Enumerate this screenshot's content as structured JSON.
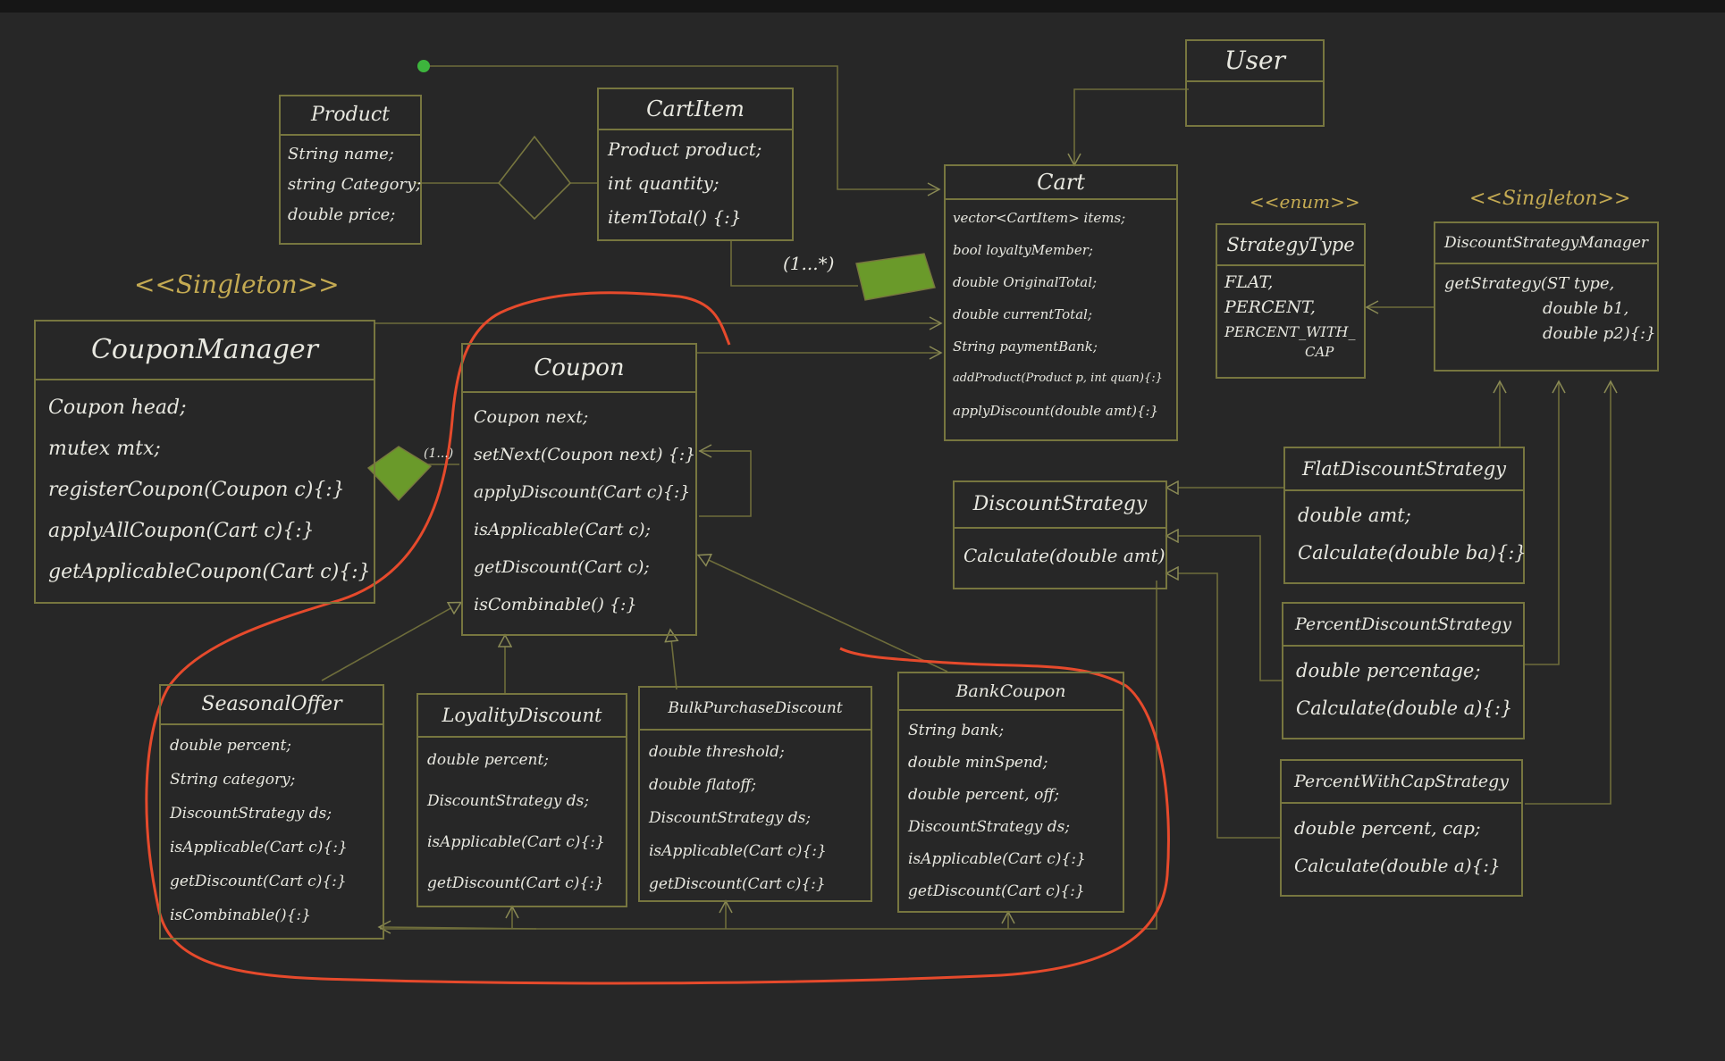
{
  "colors": {
    "background": "#272727",
    "box_border": "#77763f",
    "text": "#e8e8e0",
    "stereotype": "#c4aa52",
    "highlight": "#e64a2c",
    "dot": "#3db53d",
    "diamond_fill": "#6a9a2a"
  },
  "stereotypes": {
    "coupon_manager": "<<Singleton>>",
    "strategy_type": "<<enum>>",
    "discount_strategy_manager": "<<Singleton>>"
  },
  "multiplicity": {
    "cart_items": "(1...*)",
    "coupon_chain": "(1...)"
  },
  "classes": {
    "user": {
      "name": "User"
    },
    "product": {
      "name": "Product",
      "fields": [
        "String name;",
        "string Category;",
        "double price;"
      ]
    },
    "cart_item": {
      "name": "CartItem",
      "fields": [
        "Product product;",
        "int quantity;",
        "itemTotal() {:}"
      ]
    },
    "cart": {
      "name": "Cart",
      "fields": [
        "vector<CartItem> items;",
        "bool loyaltyMember;",
        "double OriginalTotal;",
        "double currentTotal;",
        "String paymentBank;",
        "addProduct(Product p, int quan){:}",
        "applyDiscount(double amt){:}"
      ]
    },
    "strategy_type": {
      "name": "StrategyType",
      "fields": [
        "FLAT,",
        "PERCENT,",
        "PERCENT_WITH_",
        "CAP"
      ]
    },
    "discount_strategy_manager": {
      "name": "DiscountStrategyManager",
      "fields": [
        "getStrategy(ST type,",
        "double b1,",
        "double p2){:}"
      ]
    },
    "coupon_manager": {
      "name": "CouponManager",
      "fields": [
        "Coupon head;",
        "mutex mtx;",
        "registerCoupon(Coupon c){:}",
        "applyAllCoupon(Cart c){:}",
        "getApplicableCoupon(Cart c){:}"
      ]
    },
    "coupon": {
      "name": "Coupon",
      "fields": [
        "Coupon next;",
        "setNext(Coupon next) {:}",
        "applyDiscount(Cart c){:}",
        "isApplicable(Cart c);",
        "getDiscount(Cart c);",
        "isCombinable() {:}"
      ]
    },
    "discount_strategy": {
      "name": "DiscountStrategy",
      "fields": [
        "Calculate(double amt)"
      ]
    },
    "flat_discount_strategy": {
      "name": "FlatDiscountStrategy",
      "fields": [
        "double amt;",
        "Calculate(double ba){:}"
      ]
    },
    "percent_discount_strategy": {
      "name": "PercentDiscountStrategy",
      "fields": [
        "double percentage;",
        "Calculate(double a){:}"
      ]
    },
    "percent_with_cap_strategy": {
      "name": "PercentWithCapStrategy",
      "fields": [
        "double percent, cap;",
        "Calculate(double a){:}"
      ]
    },
    "seasonal_offer": {
      "name": "SeasonalOffer",
      "fields": [
        "double percent;",
        "String category;",
        "DiscountStrategy ds;",
        "isApplicable(Cart c){:}",
        "getDiscount(Cart c){:}",
        "isCombinable(){:}"
      ]
    },
    "loyalty_discount": {
      "name": "LoyalityDiscount",
      "fields": [
        "double percent;",
        "DiscountStrategy ds;",
        "isApplicable(Cart c){:}",
        "getDiscount(Cart c){:}"
      ]
    },
    "bulk_purchase_discount": {
      "name": "BulkPurchaseDiscount",
      "fields": [
        "double threshold;",
        "double flatoff;",
        "DiscountStrategy ds;",
        "isApplicable(Cart c){:}",
        "getDiscount(Cart c){:}"
      ]
    },
    "bank_coupon": {
      "name": "BankCoupon",
      "fields": [
        "String bank;",
        "double minSpend;",
        "double percent, off;",
        "DiscountStrategy ds;",
        "isApplicable(Cart c){:}",
        "getDiscount(Cart c){:}"
      ]
    }
  }
}
